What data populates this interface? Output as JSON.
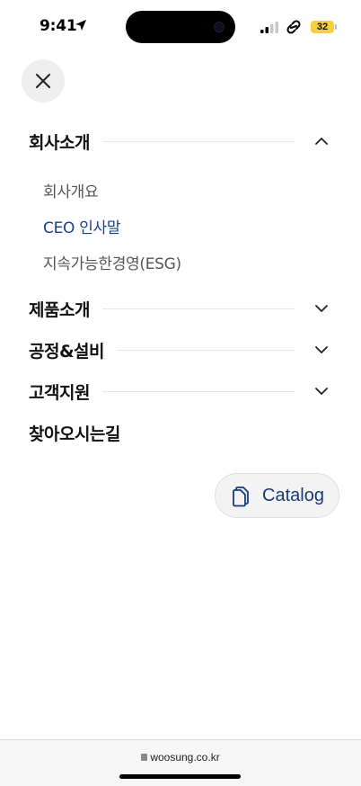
{
  "status": {
    "time": "9:41",
    "battery": "32"
  },
  "menu": {
    "close_icon": "close-icon",
    "sections": [
      {
        "label": "회사소개",
        "expanded": true,
        "items": [
          "회사개요",
          "CEO 인사말",
          "지속가능한경영(ESG)"
        ],
        "active_item": "CEO 인사말"
      },
      {
        "label": "제품소개",
        "expanded": false
      },
      {
        "label": "공정&설비",
        "expanded": false
      },
      {
        "label": "고객지원",
        "expanded": false
      },
      {
        "label": "찾아오시는길"
      }
    ]
  },
  "catalog": {
    "label": "Catalog",
    "icon": "document-copy-icon"
  },
  "browser": {
    "url": "woosung.co.kr"
  },
  "colors": {
    "accent": "#1a3f8a",
    "battery": "#f5cf3f"
  }
}
